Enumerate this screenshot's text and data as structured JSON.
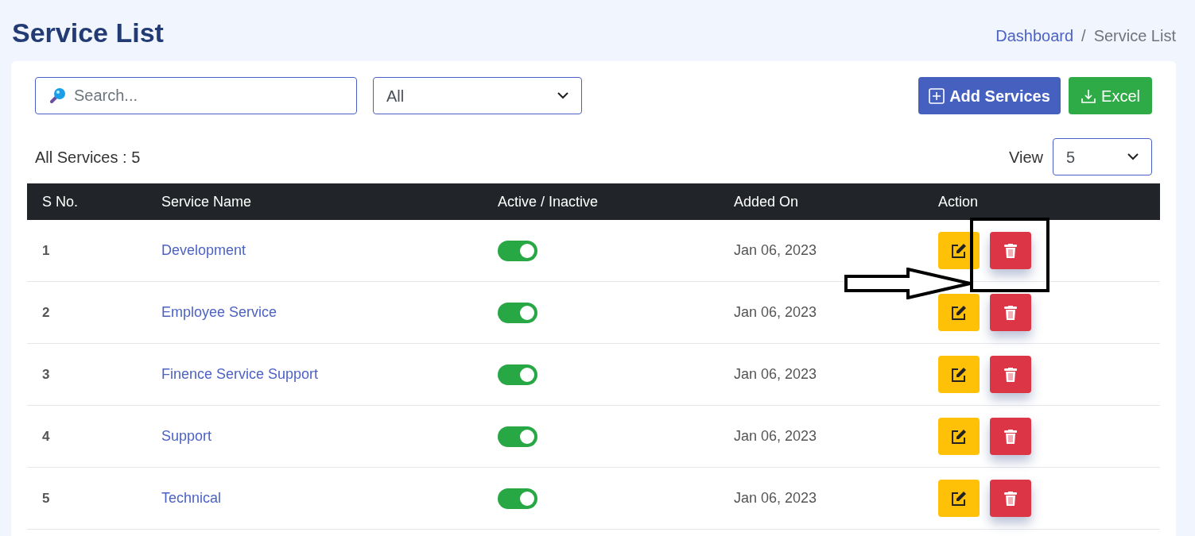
{
  "title": "Service List",
  "breadcrumb": [
    {
      "label": "Dashboard",
      "link": true
    },
    {
      "label": "Service List",
      "link": false
    }
  ],
  "breadcrumb_separator": "/",
  "search": {
    "placeholder": "Search..."
  },
  "filter": {
    "value": "All"
  },
  "buttons": [
    {
      "kind": "add",
      "label": "Add Services"
    },
    {
      "kind": "excel",
      "label": "Excel"
    }
  ],
  "count_label": "All Services : 5",
  "view": {
    "label": "View",
    "value": "5"
  },
  "table": {
    "columns": [
      "S No.",
      "Service Name",
      "Active / Inactive",
      "Added On",
      "Action"
    ],
    "rows": [
      {
        "sno": "1",
        "name": "Development",
        "active": true,
        "added_on": "Jan 06, 2023"
      },
      {
        "sno": "2",
        "name": "Employee Service",
        "active": true,
        "added_on": "Jan 06, 2023"
      },
      {
        "sno": "3",
        "name": "Finence Service Support",
        "active": true,
        "added_on": "Jan 06, 2023"
      },
      {
        "sno": "4",
        "name": "Support",
        "active": true,
        "added_on": "Jan 06, 2023"
      },
      {
        "sno": "5",
        "name": "Technical",
        "active": true,
        "added_on": "Jan 06, 2023"
      }
    ]
  }
}
